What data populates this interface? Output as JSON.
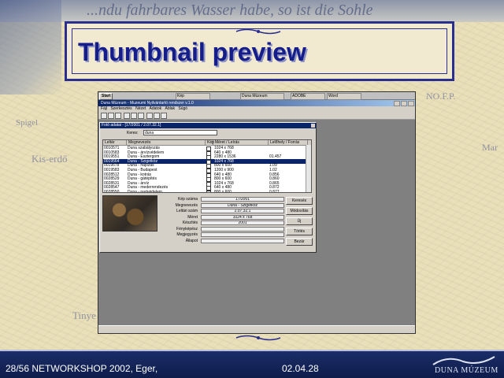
{
  "slide": {
    "title": "Thumbnail preview",
    "header_script": "...ndu fahrbares Wasser habe, so ist die Sohle",
    "map_labels": [
      "Spigel",
      "Kis-erdő",
      "Tinye",
      "NO.F.P.",
      "Mar"
    ],
    "footer_left": "28/56 NETWORKSHOP 2002, Eger,",
    "footer_date": "02.04.28",
    "footer_logo": "DUNA MÚZEUM"
  },
  "screenshot": {
    "taskbar": {
      "start_label": "Start",
      "buttons": [
        "Kép",
        "Duna Múzeum",
        "ADOBE",
        "Word"
      ]
    },
    "app_title": "Duna Múzeum - Muzeumi Nyilvántartó rendszer v.1.0",
    "menu": [
      "Fájl",
      "Szerkesztés",
      "Nézet",
      "Adatok",
      "Ablak",
      "Súgó"
    ],
    "dialog": {
      "title": "Fotó adatai - [17/2001 / 2.07.32.1]",
      "search_label": "Keres:",
      "search_value": "duna",
      "columns": [
        "Leltár",
        "Megnevezés",
        "Kép",
        "Méret / Leírás",
        "Lelőhely / Forrás"
      ],
      "rows": [
        {
          "id": "0010571",
          "name": "Duna szabályozás",
          "size": "1024 x 768",
          "loc": ""
        },
        {
          "id": "0010583",
          "name": "Duna - árvízvédelem",
          "size": "640 x 480",
          "loc": ""
        },
        {
          "id": "0019551",
          "name": "Duna - Esztergom",
          "size": "2280 x 1536",
          "loc": "01.457"
        },
        {
          "id": "0019564",
          "name": "Duna - Szigetköz",
          "size": "1024 x 768",
          "loc": ""
        },
        {
          "id": "0019578",
          "name": "Duna - hajózás",
          "size": "800 x 600",
          "loc": "1.09"
        },
        {
          "id": "0019583",
          "name": "Duna - Budapest",
          "size": "1200 x 900",
          "loc": "1.02"
        },
        {
          "id": "0028512",
          "name": "Duna - kotrás",
          "size": "640 x 480",
          "loc": "0.856"
        },
        {
          "id": "0028529",
          "name": "Duna - gátépítés",
          "size": "800 x 600",
          "loc": "0.860"
        },
        {
          "id": "0028531",
          "name": "Duna - árvíz",
          "size": "1024 x 768",
          "loc": "0.865"
        },
        {
          "id": "0028547",
          "name": "Duna - mederrendezés",
          "size": "640 x 480",
          "loc": "0.872"
        },
        {
          "id": "0028550",
          "name": "Duna - partvédelem",
          "size": "800 x 600",
          "loc": "0.877"
        }
      ],
      "selected_row_index": 3,
      "fields": [
        {
          "label": "Kép száma",
          "value": "17/2001"
        },
        {
          "label": "Megnevezés",
          "value": "Duna - Szigetköz"
        },
        {
          "label": "Leltári szám",
          "value": "2.07.32.1"
        },
        {
          "label": "Méret",
          "value": "1024 x 768"
        },
        {
          "label": "Készítés",
          "value": "2001"
        },
        {
          "label": "Fényképész",
          "value": ""
        },
        {
          "label": "Megjegyzés",
          "value": ""
        },
        {
          "label": "Állapot",
          "value": ""
        }
      ],
      "buttons": [
        "Keresés",
        "Módosítás",
        "Új",
        "Törlés",
        "Bezár"
      ]
    }
  }
}
